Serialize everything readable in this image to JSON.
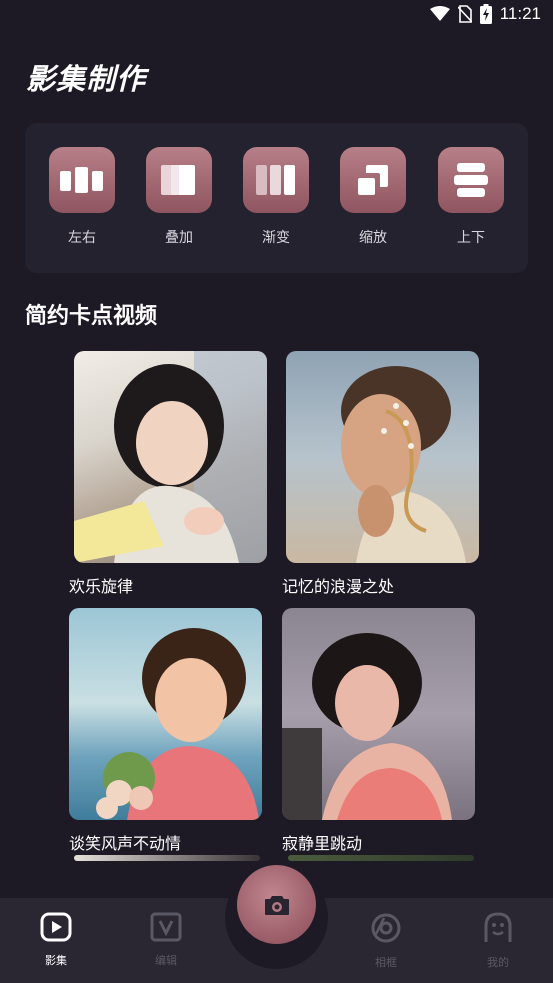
{
  "status_bar": {
    "time": "11:21"
  },
  "page_title": "影集制作",
  "effects": [
    {
      "label": "左右",
      "icon": "left-right-icon"
    },
    {
      "label": "叠加",
      "icon": "overlay-icon"
    },
    {
      "label": "渐变",
      "icon": "gradient-icon"
    },
    {
      "label": "缩放",
      "icon": "zoom-icon"
    },
    {
      "label": "上下",
      "icon": "up-down-icon"
    }
  ],
  "section_title": "简约卡点视频",
  "templates": [
    {
      "title": "欢乐旋律"
    },
    {
      "title": "记忆的浪漫之处"
    },
    {
      "title": "谈笑风声不动情"
    },
    {
      "title": "寂静里跳动"
    }
  ],
  "tabbar": {
    "items": [
      {
        "label": "影集",
        "icon": "album-play-icon",
        "active": true
      },
      {
        "label": "编辑",
        "icon": "edit-v-icon",
        "active": false
      },
      {
        "label": "相框",
        "icon": "frame-camera-icon",
        "active": false
      },
      {
        "label": "我的",
        "icon": "profile-face-icon",
        "active": false
      }
    ],
    "camera_icon": "camera-icon"
  },
  "colors": {
    "background": "#1d1a26",
    "panel": "#25222f",
    "accent": "#a7707a",
    "tab_inactive": "#5b5866"
  }
}
